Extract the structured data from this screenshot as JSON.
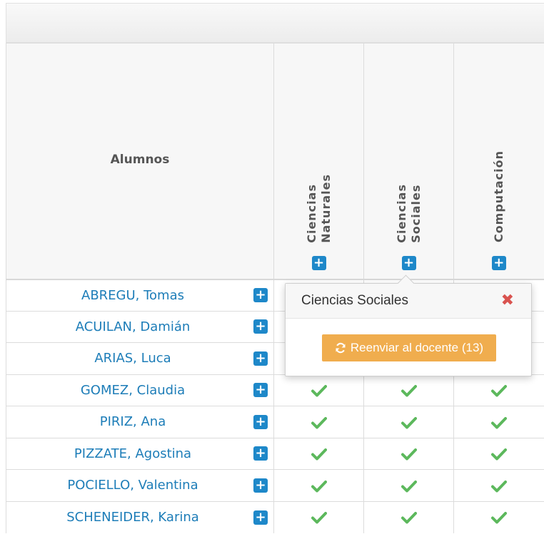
{
  "header": {
    "students_label": "Alumnos",
    "subjects": [
      {
        "label": "Ciencias\nNaturales"
      },
      {
        "label": "Ciencias\nSociales"
      },
      {
        "label": "Computación"
      }
    ],
    "add_icon": "plus-square-icon"
  },
  "students": [
    {
      "name": "ABREGU, Tomas"
    },
    {
      "name": "ACUILAN, Damián"
    },
    {
      "name": "ARIAS, Luca"
    },
    {
      "name": "GOMEZ, Claudia"
    },
    {
      "name": "PIRIZ, Ana"
    },
    {
      "name": "PIZZATE, Agostina"
    },
    {
      "name": "POCIELLO, Valentina"
    },
    {
      "name": "SCHENEIDER, Karina"
    }
  ],
  "popover": {
    "title": "Ciencias Sociales",
    "close_icon": "times-icon",
    "resend_label": "Reenviar al docente (13)",
    "refresh_icon": "refresh-icon"
  },
  "colors": {
    "accent": "#1e88c9",
    "check": "#5cb85c",
    "warning": "#f0ad4e",
    "danger": "#d9534f",
    "link": "#1d7db8"
  }
}
